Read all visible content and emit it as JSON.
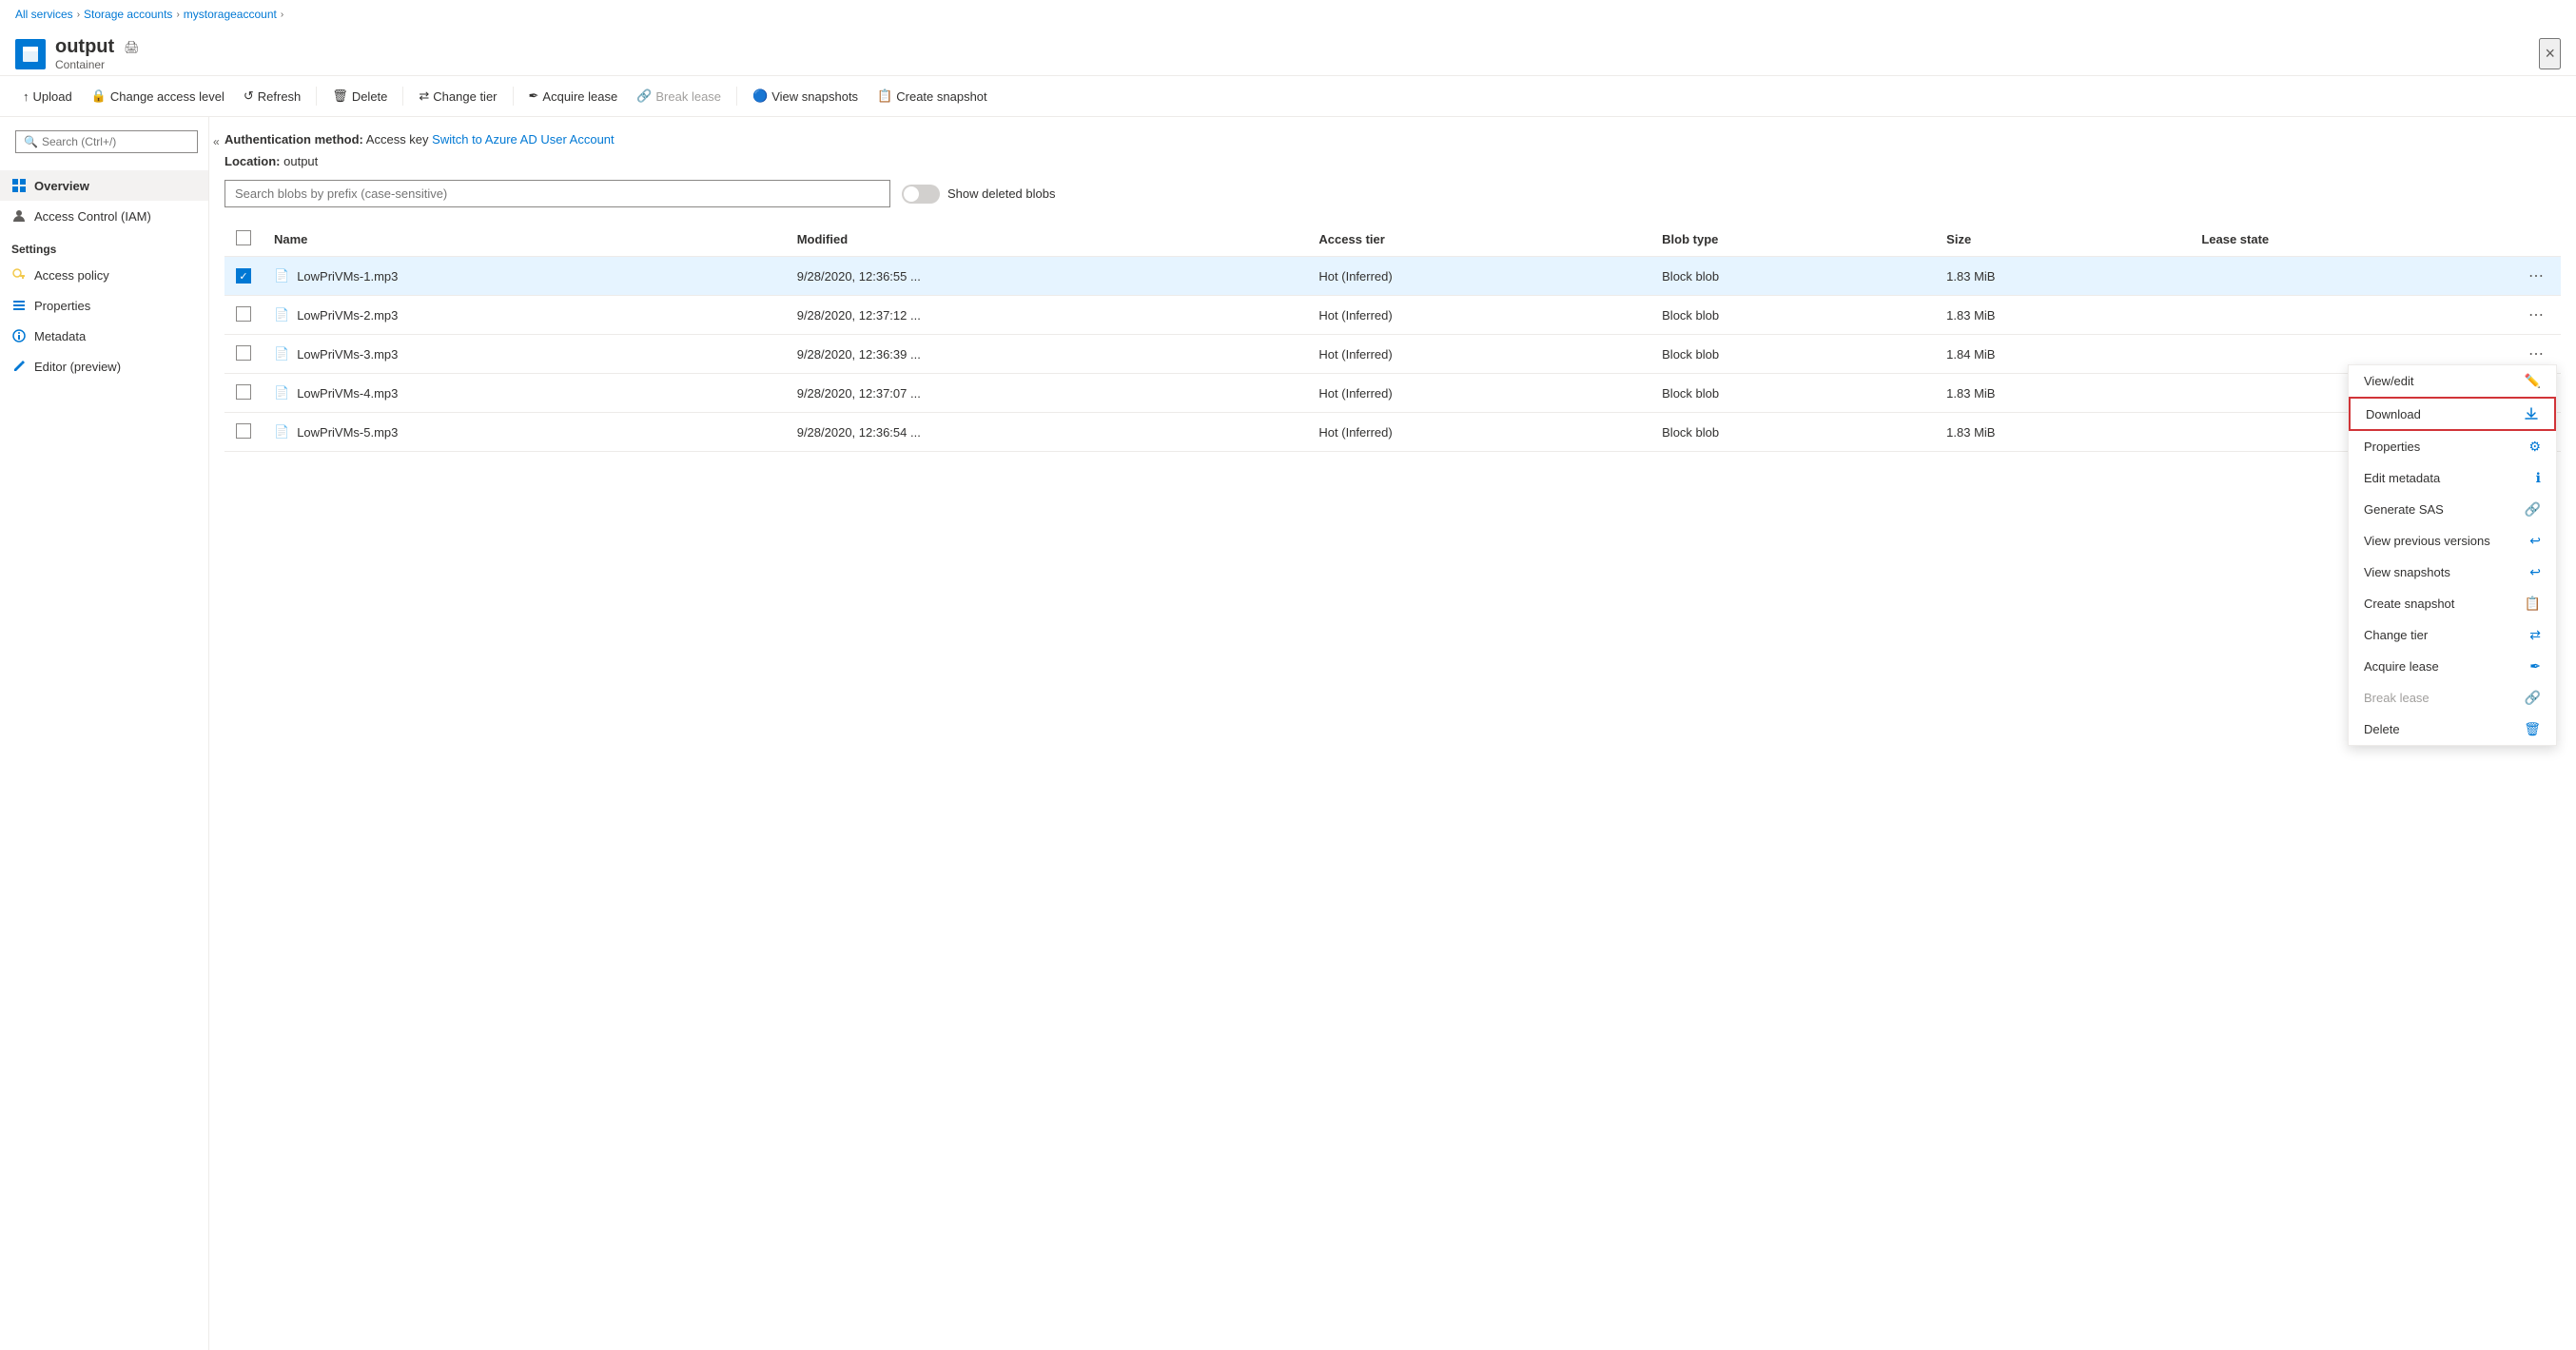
{
  "breadcrumb": {
    "all_services": "All services",
    "storage_accounts": "Storage accounts",
    "account_name": "mystorageaccount"
  },
  "header": {
    "title": "output",
    "subtitle": "Container",
    "close_label": "×"
  },
  "toolbar": {
    "upload": "Upload",
    "change_access_level": "Change access level",
    "refresh": "Refresh",
    "delete": "Delete",
    "change_tier": "Change tier",
    "acquire_lease": "Acquire lease",
    "break_lease": "Break lease",
    "view_snapshots": "View snapshots",
    "create_snapshot": "Create snapshot"
  },
  "sidebar": {
    "search_placeholder": "Search (Ctrl+/)",
    "nav_items": [
      {
        "id": "overview",
        "label": "Overview",
        "active": true,
        "icon": "grid"
      },
      {
        "id": "iam",
        "label": "Access Control (IAM)",
        "active": false,
        "icon": "person"
      }
    ],
    "settings_label": "Settings",
    "settings_items": [
      {
        "id": "access-policy",
        "label": "Access policy",
        "icon": "key"
      },
      {
        "id": "properties",
        "label": "Properties",
        "icon": "bars"
      },
      {
        "id": "metadata",
        "label": "Metadata",
        "icon": "info"
      },
      {
        "id": "editor",
        "label": "Editor (preview)",
        "icon": "pencil"
      }
    ]
  },
  "content": {
    "auth_label": "Authentication method:",
    "auth_value": "Access key",
    "auth_link": "Switch to Azure AD User Account",
    "location_label": "Location:",
    "location_value": "output",
    "search_placeholder": "Search blobs by prefix (case-sensitive)",
    "show_deleted_label": "Show deleted blobs",
    "table": {
      "columns": [
        "Name",
        "Modified",
        "Access tier",
        "Blob type",
        "Size",
        "Lease state"
      ],
      "rows": [
        {
          "name": "LowPriVMs-1.mp3",
          "modified": "9/28/2020, 12:36:55 ...",
          "access_tier": "Hot (Inferred)",
          "blob_type": "Block blob",
          "size": "1.83 MiB",
          "lease_state": "",
          "selected": true
        },
        {
          "name": "LowPriVMs-2.mp3",
          "modified": "9/28/2020, 12:37:12 ...",
          "access_tier": "Hot (Inferred)",
          "blob_type": "Block blob",
          "size": "1.83 MiB",
          "lease_state": "",
          "selected": false
        },
        {
          "name": "LowPriVMs-3.mp3",
          "modified": "9/28/2020, 12:36:39 ...",
          "access_tier": "Hot (Inferred)",
          "blob_type": "Block blob",
          "size": "1.84 MiB",
          "lease_state": "",
          "selected": false
        },
        {
          "name": "LowPriVMs-4.mp3",
          "modified": "9/28/2020, 12:37:07 ...",
          "access_tier": "Hot (Inferred)",
          "blob_type": "Block blob",
          "size": "1.83 MiB",
          "lease_state": "",
          "selected": false
        },
        {
          "name": "LowPriVMs-5.mp3",
          "modified": "9/28/2020, 12:36:54 ...",
          "access_tier": "Hot (Inferred)",
          "blob_type": "Block blob",
          "size": "1.83 MiB",
          "lease_state": "",
          "selected": false
        }
      ]
    },
    "context_menu": {
      "items": [
        {
          "id": "view-edit",
          "label": "View/edit",
          "icon": "pencil",
          "highlighted": false,
          "disabled": false
        },
        {
          "id": "download",
          "label": "Download",
          "icon": "download",
          "highlighted": true,
          "disabled": false
        },
        {
          "id": "properties",
          "label": "Properties",
          "icon": "settings",
          "highlighted": false,
          "disabled": false
        },
        {
          "id": "edit-metadata",
          "label": "Edit metadata",
          "icon": "info",
          "highlighted": false,
          "disabled": false
        },
        {
          "id": "generate-sas",
          "label": "Generate SAS",
          "icon": "link",
          "highlighted": false,
          "disabled": false
        },
        {
          "id": "view-previous",
          "label": "View previous versions",
          "icon": "history",
          "highlighted": false,
          "disabled": false
        },
        {
          "id": "view-snapshots",
          "label": "View snapshots",
          "icon": "history",
          "highlighted": false,
          "disabled": false
        },
        {
          "id": "create-snapshot",
          "label": "Create snapshot",
          "icon": "copy",
          "highlighted": false,
          "disabled": false
        },
        {
          "id": "change-tier",
          "label": "Change tier",
          "icon": "refresh",
          "highlighted": false,
          "disabled": false
        },
        {
          "id": "acquire-lease",
          "label": "Acquire lease",
          "icon": "tag",
          "highlighted": false,
          "disabled": false
        },
        {
          "id": "break-lease",
          "label": "Break lease",
          "icon": "tag-disabled",
          "highlighted": false,
          "disabled": true
        },
        {
          "id": "delete",
          "label": "Delete",
          "icon": "trash",
          "highlighted": false,
          "disabled": false
        }
      ]
    }
  }
}
